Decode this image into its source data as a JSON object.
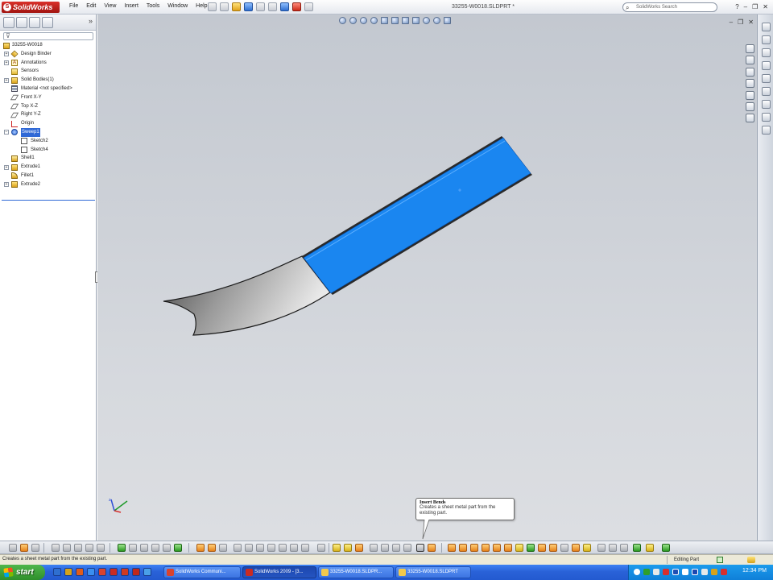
{
  "app": {
    "logo_text": "SolidWorks",
    "document_title": "33255-W0018.SLDPRT *",
    "menus": [
      "File",
      "Edit",
      "View",
      "Insert",
      "Tools",
      "Window",
      "Help"
    ],
    "search_placeholder": "SolidWorks Search"
  },
  "feature_tree": {
    "root": "33255-W0018",
    "items": [
      {
        "label": "Design Binder",
        "icon": "design-binder-icon",
        "expandable": true
      },
      {
        "label": "Annotations",
        "icon": "annotations-icon",
        "expandable": true
      },
      {
        "label": "Sensors",
        "icon": "sensors-icon",
        "expandable": false
      },
      {
        "label": "Solid Bodies(1)",
        "icon": "solid-bodies-icon",
        "expandable": true
      },
      {
        "label": "Material <not specified>",
        "icon": "material-icon",
        "expandable": false
      },
      {
        "label": "Front X-Y",
        "icon": "plane-icon",
        "expandable": false
      },
      {
        "label": "Top X-Z",
        "icon": "plane-icon",
        "expandable": false
      },
      {
        "label": "Right Y-Z",
        "icon": "plane-icon",
        "expandable": false
      },
      {
        "label": "Origin",
        "icon": "origin-icon",
        "expandable": false
      },
      {
        "label": "Sweep1",
        "icon": "sweep-icon",
        "expandable": true,
        "expanded": true,
        "selected": true
      },
      {
        "label": "Sketch2",
        "icon": "sketch-icon",
        "child": true
      },
      {
        "label": "Sketch4",
        "icon": "sketch-icon",
        "child": true
      },
      {
        "label": "Shell1",
        "icon": "shell-icon",
        "expandable": false
      },
      {
        "label": "Extrude1",
        "icon": "extrude-icon",
        "expandable": true
      },
      {
        "label": "Fillet1",
        "icon": "fillet-icon",
        "expandable": false
      },
      {
        "label": "Extrude2",
        "icon": "extrude-icon",
        "expandable": true
      }
    ]
  },
  "tooltip": {
    "title": "Insert Bends",
    "description": "Creates a sheet metal part from the existing part."
  },
  "status_bar": {
    "message": "Creates a sheet metal part from the existing part.",
    "mode": "Editing Part"
  },
  "taskbar": {
    "start_label": "start",
    "tasks": [
      {
        "label": "SolidWorks Communi...",
        "icon_color": "#d9432e"
      },
      {
        "label": "SolidWorks 2009 - [3...",
        "icon_color": "#c92b22",
        "active": true
      },
      {
        "label": "33255-W0018.SLDPR...",
        "icon_color": "#f2c94c"
      },
      {
        "label": "33255-W0018.SLDPRT",
        "icon_color": "#f2c94c"
      }
    ],
    "clock": "12:34 PM"
  },
  "colors": {
    "part_face_blue": "#1a86f0",
    "selection_blue": "#2f68d6",
    "viewport_bg": "#cfd3d9"
  }
}
